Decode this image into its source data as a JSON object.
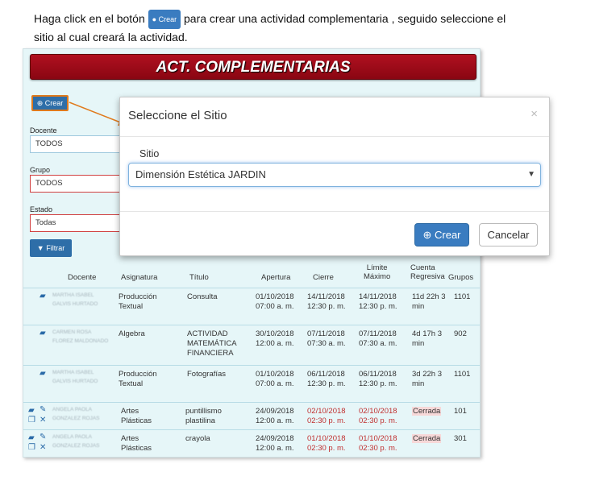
{
  "instruction": {
    "part1": "Haga click en el botón",
    "button_label": "Crear",
    "part2": "para crear una actividad complementaria , seguido seleccione el sitio al cual creará la actividad."
  },
  "app": {
    "banner_title": "ACT. COMPLEMENTARIAS",
    "crear_label": "Crear",
    "filters": {
      "docente_label": "Docente",
      "docente_value": "TODOS",
      "grupo_label": "Grupo",
      "grupo_value": "TODOS",
      "estado_label": "Estado",
      "estado_value": "Todas"
    },
    "filtrar_label": "Filtrar",
    "table": {
      "headers": {
        "docente": "Docente",
        "asignatura": "Asignatura",
        "titulo": "Título",
        "apertura": "Apertura",
        "cierre": "Cierre",
        "limite1": "Límite",
        "limite2": "Máximo",
        "cuenta1": "Cuenta",
        "cuenta2": "Regresiva",
        "grupos": "Grupos"
      },
      "rows": [
        {
          "docente": "MARTHA ISABEL GALVIS HURTADO",
          "asig1": "Producción",
          "asig2": "Textual",
          "tit1": "Consulta",
          "tit2": "",
          "tit3": "",
          "ap1": "01/10/2018",
          "ap2": "07:00 a. m.",
          "ci1": "14/11/2018",
          "ci2": "12:30 p. m.",
          "li1": "14/11/2018",
          "li2": "12:30 p. m.",
          "cu1": "11d 22h 3",
          "cu2": "min",
          "grupos": "1101"
        },
        {
          "docente": "CARMEN ROSA FLOREZ MALDONADO",
          "asig1": "Algebra",
          "asig2": "",
          "tit1": "ACTIVIDAD",
          "tit2": "MATEMÁTICA",
          "tit3": "FINANCIERA",
          "ap1": "30/10/2018",
          "ap2": "12:00 a. m.",
          "ci1": "07/11/2018",
          "ci2": "07:30 a. m.",
          "li1": "07/11/2018",
          "li2": "07:30 a. m.",
          "cu1": "4d 17h 3",
          "cu2": "min",
          "grupos": "902"
        },
        {
          "docente": "MARTHA ISABEL GALVIS HURTADO",
          "asig1": "Producción",
          "asig2": "Textual",
          "tit1": "Fotografías",
          "tit2": "",
          "tit3": "",
          "ap1": "01/10/2018",
          "ap2": "07:00 a. m.",
          "ci1": "06/11/2018",
          "ci2": "12:30 p. m.",
          "li1": "06/11/2018",
          "li2": "12:30 p. m.",
          "cu1": "3d 22h 3",
          "cu2": "min",
          "grupos": "1101"
        },
        {
          "docente": "ANGELA PAOLA GONZALEZ ROJAS",
          "asig1": "Artes",
          "asig2": "Plásticas",
          "tit1": "puntillismo",
          "tit2": "plastilina",
          "tit3": "",
          "ap1": "24/09/2018",
          "ap2": "12:00 a. m.",
          "ci1": "02/10/2018",
          "ci2": "02:30 p. m.",
          "li1": "02/10/2018",
          "li2": "02:30 p. m.",
          "cu1": "Cerrada",
          "cu2": "",
          "grupos": "101"
        },
        {
          "docente": "ANGELA PAOLA GONZALEZ ROJAS",
          "asig1": "Artes",
          "asig2": "Plásticas",
          "tit1": "crayola",
          "tit2": "",
          "tit3": "",
          "ap1": "24/09/2018",
          "ap2": "12:00 a. m.",
          "ci1": "01/10/2018",
          "ci2": "02:30 p. m.",
          "li1": "01/10/2018",
          "li2": "02:30 p. m.",
          "cu1": "Cerrada",
          "cu2": "",
          "grupos": "301"
        }
      ]
    }
  },
  "modal": {
    "title": "Seleccione el Sitio",
    "close": "×",
    "sitio_label": "Sitio",
    "sitio_value": "Dimensión Estética JARDIN",
    "crear_label": "Crear",
    "cancel_label": "Cancelar"
  },
  "colors": {
    "banner": "#a00c1a",
    "primary": "#2e6ea8",
    "highlight": "#e07a1c",
    "closed": "#c03030"
  }
}
